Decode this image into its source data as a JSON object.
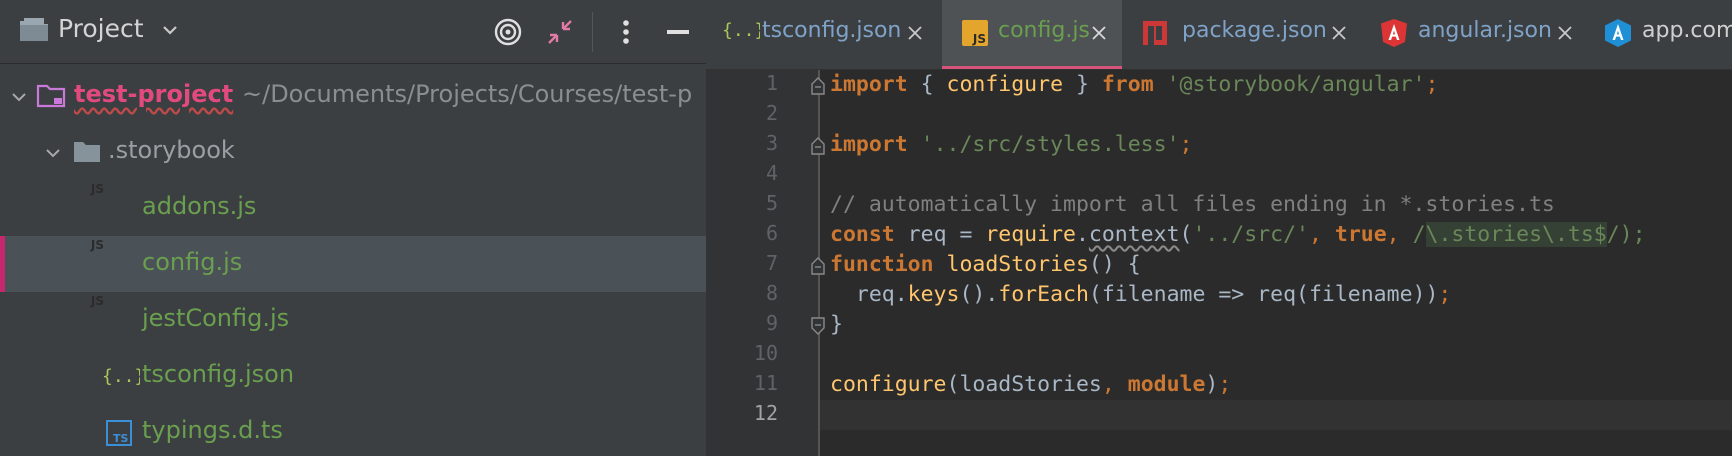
{
  "project_panel": {
    "title": "Project",
    "tree": {
      "root": {
        "name": "test-project",
        "path": "~/Documents/Projects/Courses/test-p"
      },
      "folder": {
        "name": ".storybook"
      },
      "files": [
        {
          "name": "addons.js",
          "icon": "js-file-icon"
        },
        {
          "name": "config.js",
          "icon": "js-file-icon",
          "selected": true
        },
        {
          "name": "jestConfig.js",
          "icon": "js-file-icon"
        },
        {
          "name": "tsconfig.json",
          "icon": "json-file-icon"
        },
        {
          "name": "typings.d.ts",
          "icon": "ts-file-icon"
        }
      ]
    }
  },
  "editor": {
    "tabs": [
      {
        "label": "tsconfig.json",
        "icon": "json-file-icon"
      },
      {
        "label": "config.js",
        "icon": "js-file-icon",
        "active": true
      },
      {
        "label": "package.json",
        "icon": "npm-icon"
      },
      {
        "label": "angular.json",
        "icon": "angular-icon"
      },
      {
        "label": "app.com",
        "icon": "angular-component-icon"
      }
    ],
    "line_numbers": [
      "1",
      "2",
      "3",
      "4",
      "5",
      "6",
      "7",
      "8",
      "9",
      "10",
      "11",
      "12"
    ],
    "current_line": "12",
    "code": {
      "l1_import": "import",
      "l1_a": " { ",
      "l1_configure": "configure",
      "l1_b": " } ",
      "l1_from": "from",
      "l1_str": "'@storybook/angular'",
      "l1_semi": ";",
      "l3_import": "import",
      "l3_str": "'../src/styles.less'",
      "l3_semi": ";",
      "l5_comment": "// automatically import all files ending in *.stories.ts",
      "l6_const": "const",
      "l6_a": " req = ",
      "l6_require": "require",
      "l6_dot": ".",
      "l6_context": "context",
      "l6_paren": "(",
      "l6_str": "'../src/'",
      "l6_comma1": ",",
      "l6_true": "true",
      "l6_comma2": ",",
      "l6_slash": "/",
      "l6_regex": "\\.stories\\.ts$",
      "l6_end": "/);",
      "l7_function": "function",
      "l7_name": "loadStories",
      "l7_rest": "() {",
      "l8_a": "  req.",
      "l8_keys": "keys",
      "l8_b": "().",
      "l8_foreach": "forEach",
      "l8_c": "(filename => req(filename))",
      "l8_semi": ";",
      "l9": "}",
      "l11_configure": "configure",
      "l11_a": "(loadStories",
      "l11_comma": ",",
      "l11_module": "module",
      "l11_end": ")",
      "l11_semi": ";"
    }
  }
}
